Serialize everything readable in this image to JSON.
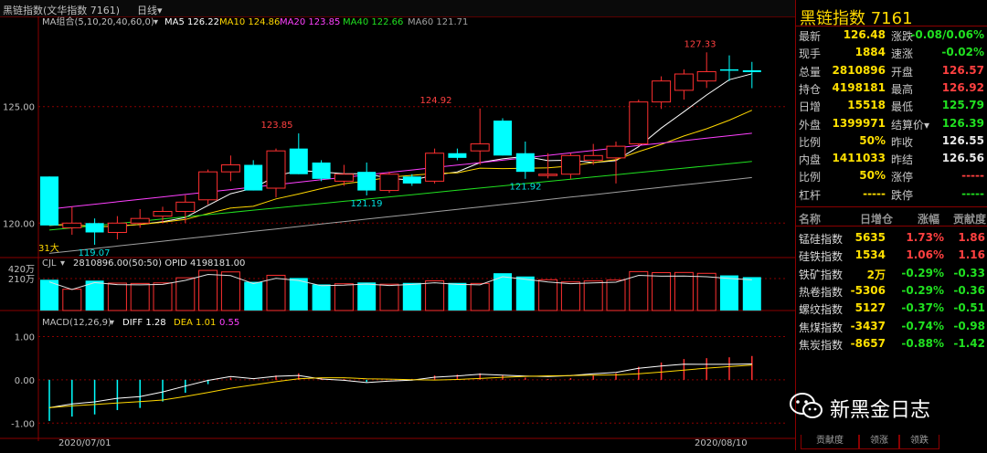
{
  "titlebar": {
    "name": "黑链指数(文华指数 7161)",
    "period": "日线",
    "period_arrow": "▾"
  },
  "ma_legend": {
    "name": "MA组合(5,10,20,40,60,0)",
    "arrow": "▾",
    "items": [
      {
        "label": "MA5 126.22",
        "color": "#ffffff"
      },
      {
        "label": "MA10 124.86",
        "color": "#ffd700"
      },
      {
        "label": "MA20 123.85",
        "color": "#ff40ff"
      },
      {
        "label": "MA40 122.66",
        "color": "#20e020"
      },
      {
        "label": "MA60 121.71",
        "color": "#a0a0a0"
      }
    ]
  },
  "price_axis": {
    "labels": [
      "125.00",
      "120.00"
    ]
  },
  "price_annotations": [
    "127.33",
    "124.92",
    "123.85",
    "121.19",
    "121.92",
    "119.07"
  ],
  "day_marker": "31大",
  "vol_legend": {
    "name": "CJL",
    "arrow": "▾",
    "text": "2810896.00(50:50)  OPID 4198181.00"
  },
  "vol_axis": {
    "labels": [
      "420万",
      "210万"
    ]
  },
  "macd_legend": {
    "name": "MACD(12,26,9)",
    "arrow": "▾",
    "diff": "DIFF 1.28",
    "dea": "DEA 1.01",
    "macd": "0.55"
  },
  "macd_axis": {
    "labels": [
      "1.00",
      "0.00",
      "-1.00"
    ]
  },
  "date_axis": {
    "labels": [
      "2020/07/01",
      "2020/08/10"
    ]
  },
  "chart_data": {
    "type": "candlestick",
    "x": [
      "d1",
      "d2",
      "d3",
      "d4",
      "d5",
      "d6",
      "d7",
      "d8",
      "d9",
      "d10",
      "d11",
      "d12",
      "d13",
      "d14",
      "d15",
      "d16",
      "d17",
      "d18",
      "d19",
      "d20",
      "d21",
      "d22",
      "d23",
      "d24",
      "d25",
      "d26",
      "d27",
      "d28",
      "d29",
      "d30",
      "d31",
      "d32"
    ],
    "ohlc": [
      [
        122.0,
        122.0,
        119.9,
        119.9
      ],
      [
        119.8,
        120.7,
        119.5,
        120.0
      ],
      [
        120.0,
        120.2,
        119.07,
        119.6
      ],
      [
        119.6,
        120.3,
        119.3,
        120.0
      ],
      [
        120.0,
        120.6,
        119.8,
        120.2
      ],
      [
        120.3,
        120.7,
        120.0,
        120.5
      ],
      [
        120.5,
        121.2,
        120.0,
        120.9
      ],
      [
        121.0,
        122.3,
        120.8,
        122.2
      ],
      [
        122.2,
        122.9,
        121.8,
        122.5
      ],
      [
        122.5,
        122.7,
        121.4,
        121.4
      ],
      [
        121.5,
        123.2,
        121.1,
        123.1
      ],
      [
        123.2,
        123.85,
        122.1,
        122.1
      ],
      [
        122.6,
        122.7,
        121.8,
        121.9
      ],
      [
        121.8,
        122.5,
        121.6,
        122.1
      ],
      [
        122.2,
        122.6,
        121.19,
        121.4
      ],
      [
        121.4,
        122.2,
        121.3,
        122.1
      ],
      [
        122.0,
        122.1,
        121.6,
        121.7
      ],
      [
        121.8,
        123.2,
        121.7,
        123.0
      ],
      [
        123.0,
        123.2,
        122.7,
        122.8
      ],
      [
        123.1,
        124.92,
        122.5,
        123.4
      ],
      [
        124.4,
        124.5,
        122.9,
        122.9
      ],
      [
        123.0,
        123.5,
        121.9,
        122.2
      ],
      [
        122.1,
        123.0,
        121.92,
        122.1
      ],
      [
        122.1,
        123.0,
        121.9,
        122.9
      ],
      [
        122.7,
        123.4,
        122.5,
        122.9
      ],
      [
        122.8,
        123.5,
        121.7,
        123.3
      ],
      [
        123.4,
        125.3,
        123.3,
        125.2
      ],
      [
        125.2,
        126.3,
        124.9,
        126.1
      ],
      [
        125.7,
        126.6,
        125.3,
        126.4
      ],
      [
        126.1,
        127.33,
        125.8,
        126.5
      ],
      [
        126.6,
        127.2,
        126.1,
        126.57
      ],
      [
        126.56,
        126.92,
        125.79,
        126.48
      ]
    ],
    "volume_wan": [
      199,
      112,
      191,
      168,
      165,
      170,
      217,
      285,
      271,
      180,
      240,
      215,
      156,
      162,
      174,
      158,
      170,
      189,
      170,
      165,
      259,
      229,
      199,
      179,
      188,
      196,
      274,
      265,
      266,
      258,
      239,
      223
    ],
    "macd": [
      -0.95,
      -0.85,
      -0.8,
      -0.7,
      -0.65,
      -0.5,
      -0.3,
      -0.1,
      0.05,
      0.0,
      0.1,
      0.15,
      0.05,
      0.02,
      -0.05,
      0.0,
      0.02,
      0.1,
      0.12,
      0.15,
      0.1,
      0.05,
      0.02,
      0.04,
      0.1,
      0.15,
      0.3,
      0.4,
      0.48,
      0.5,
      0.52,
      0.55
    ],
    "ylim_price": [
      118.6,
      128.4
    ],
    "ylim_vol_wan": [
      0,
      420
    ],
    "ylim_macd": [
      -1.1,
      1.6
    ]
  },
  "panel": {
    "title": "黑链指数  7161",
    "rows": [
      {
        "l1": "最新",
        "v1": "126.48",
        "c1": "y",
        "l2": "涨跌",
        "v2": "-0.08/0.06%",
        "c2": "g"
      },
      {
        "l1": "现手",
        "v1": "1884",
        "c1": "y",
        "l2": "速涨",
        "v2": "-0.02%",
        "c2": "g"
      },
      {
        "l1": "总量",
        "v1": "2810896",
        "c1": "y",
        "l2": "开盘",
        "v2": "126.57",
        "c2": "r"
      },
      {
        "l1": "持仓",
        "v1": "4198181",
        "c1": "y",
        "l2": "最高",
        "v2": "126.92",
        "c2": "r"
      },
      {
        "l1": "日增",
        "v1": "15518",
        "c1": "y",
        "l2": "最低",
        "v2": "125.79",
        "c2": "g"
      },
      {
        "l1": "外盘",
        "v1": "1399971",
        "c1": "y",
        "l2": "结算价",
        "arrow": "▾",
        "v2": "126.39",
        "c2": "g"
      },
      {
        "l1": "比例",
        "v1": "50%",
        "c1": "y",
        "l2": "昨收",
        "v2": "126.55",
        "c2": "w"
      },
      {
        "l1": "内盘",
        "v1": "1411033",
        "c1": "y",
        "l2": "昨结",
        "v2": "126.56",
        "c2": "w"
      },
      {
        "l1": "比例",
        "v1": "50%",
        "c1": "y",
        "l2": "涨停",
        "v2": "-----",
        "c2": "r"
      },
      {
        "l1": "杠杆",
        "v1": "-----",
        "c1": "y",
        "l2": "跌停",
        "v2": "-----",
        "c2": "g"
      }
    ],
    "table_headers": [
      "名称",
      "日增仓",
      "涨幅",
      "贡献度"
    ],
    "indices": [
      {
        "name": "锰硅指数",
        "inc": "5635",
        "chg": "1.73%",
        "contrib": "1.86",
        "c": "r"
      },
      {
        "name": "硅铁指数",
        "inc": "1534",
        "chg": "1.06%",
        "contrib": "1.16",
        "c": "r"
      },
      {
        "name": "铁矿指数",
        "inc": "2万",
        "chg": "-0.29%",
        "contrib": "-0.33",
        "c": "g"
      },
      {
        "name": "热卷指数",
        "inc": "-5306",
        "chg": "-0.29%",
        "contrib": "-0.36",
        "c": "g"
      },
      {
        "name": "螺纹指数",
        "inc": "5127",
        "chg": "-0.37%",
        "contrib": "-0.51",
        "c": "g"
      },
      {
        "name": "焦煤指数",
        "inc": "-3437",
        "chg": "-0.74%",
        "contrib": "-0.98",
        "c": "g"
      },
      {
        "name": "焦炭指数",
        "inc": "-8657",
        "chg": "-0.88%",
        "contrib": "-1.42",
        "c": "g"
      }
    ],
    "tabs": [
      "贡献度",
      "领涨",
      "领跌"
    ]
  },
  "watermark": {
    "text": "新黑金日志"
  }
}
